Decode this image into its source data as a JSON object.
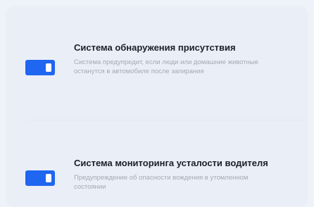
{
  "settings": {
    "items": [
      {
        "title": "Система обнаружения присутствия",
        "description": "Система предупредит, если люди или домашние животные останутся в автомобиле после запирания",
        "enabled": true
      },
      {
        "title": "Система мониторинга усталости водителя",
        "description": "Предупреждение об опасности вождения в утомленном состоянии",
        "enabled": true
      }
    ]
  },
  "colors": {
    "toggle_on": "#1f66f0",
    "background": "#eef2f9",
    "title_text": "#1b1f27",
    "description_text": "#a3a9b3"
  }
}
